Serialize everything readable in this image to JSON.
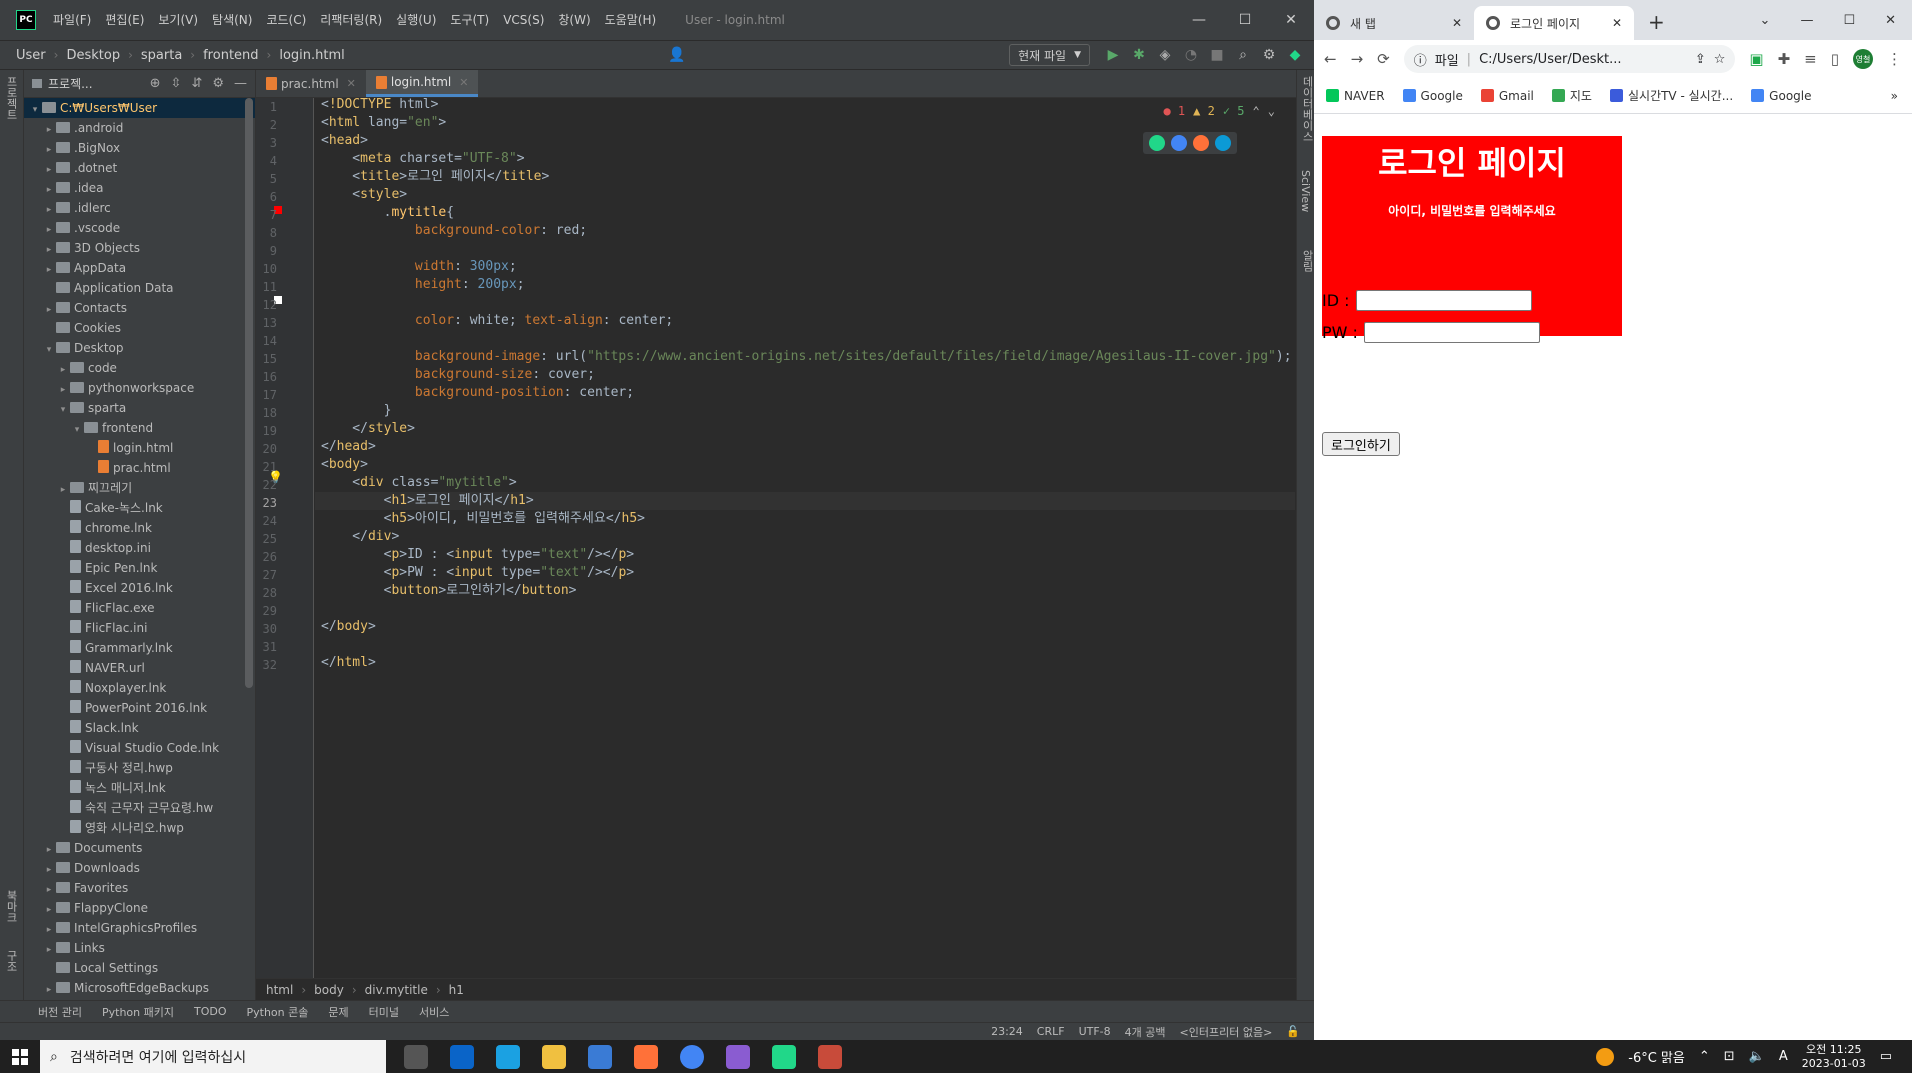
{
  "ide": {
    "logo": "PC",
    "menu": [
      "파일(F)",
      "편집(E)",
      "보기(V)",
      "탐색(N)",
      "코드(C)",
      "리팩터링(R)",
      "실행(U)",
      "도구(T)",
      "VCS(S)",
      "창(W)",
      "도움말(H)"
    ],
    "window_title": "User - login.html",
    "breadcrumbs": [
      "User",
      "Desktop",
      "sparta",
      "frontend",
      "login.html"
    ],
    "run_config": "현재 파일",
    "project_label": "프로젝...",
    "tree": [
      {
        "label": "C:₩Users₩User",
        "depth": 0,
        "type": "folder",
        "arrow": "▾",
        "selected": true
      },
      {
        "label": ".android",
        "depth": 1,
        "type": "folder",
        "arrow": "▸"
      },
      {
        "label": ".BigNox",
        "depth": 1,
        "type": "folder",
        "arrow": "▸"
      },
      {
        "label": ".dotnet",
        "depth": 1,
        "type": "folder",
        "arrow": "▸"
      },
      {
        "label": ".idea",
        "depth": 1,
        "type": "folder",
        "arrow": "▸"
      },
      {
        "label": ".idlerc",
        "depth": 1,
        "type": "folder",
        "arrow": "▸"
      },
      {
        "label": ".vscode",
        "depth": 1,
        "type": "folder",
        "arrow": "▸"
      },
      {
        "label": "3D Objects",
        "depth": 1,
        "type": "folder",
        "arrow": "▸"
      },
      {
        "label": "AppData",
        "depth": 1,
        "type": "folder",
        "arrow": "▸"
      },
      {
        "label": "Application Data",
        "depth": 1,
        "type": "folder",
        "arrow": ""
      },
      {
        "label": "Contacts",
        "depth": 1,
        "type": "folder",
        "arrow": "▸"
      },
      {
        "label": "Cookies",
        "depth": 1,
        "type": "folder",
        "arrow": ""
      },
      {
        "label": "Desktop",
        "depth": 1,
        "type": "folder",
        "arrow": "▾"
      },
      {
        "label": "code",
        "depth": 2,
        "type": "folder",
        "arrow": "▸"
      },
      {
        "label": "pythonworkspace",
        "depth": 2,
        "type": "folder",
        "arrow": "▸"
      },
      {
        "label": "sparta",
        "depth": 2,
        "type": "folder",
        "arrow": "▾"
      },
      {
        "label": "frontend",
        "depth": 3,
        "type": "folder",
        "arrow": "▾"
      },
      {
        "label": "login.html",
        "depth": 4,
        "type": "html",
        "arrow": ""
      },
      {
        "label": "prac.html",
        "depth": 4,
        "type": "html",
        "arrow": ""
      },
      {
        "label": "찌끄레기",
        "depth": 2,
        "type": "folder",
        "arrow": "▸"
      },
      {
        "label": "Cake-녹스.lnk",
        "depth": 2,
        "type": "file",
        "arrow": ""
      },
      {
        "label": "chrome.lnk",
        "depth": 2,
        "type": "file",
        "arrow": ""
      },
      {
        "label": "desktop.ini",
        "depth": 2,
        "type": "file",
        "arrow": ""
      },
      {
        "label": "Epic Pen.lnk",
        "depth": 2,
        "type": "file",
        "arrow": ""
      },
      {
        "label": "Excel 2016.lnk",
        "depth": 2,
        "type": "file",
        "arrow": ""
      },
      {
        "label": "FlicFlac.exe",
        "depth": 2,
        "type": "file",
        "arrow": ""
      },
      {
        "label": "FlicFlac.ini",
        "depth": 2,
        "type": "file",
        "arrow": ""
      },
      {
        "label": "Grammarly.lnk",
        "depth": 2,
        "type": "file",
        "arrow": ""
      },
      {
        "label": "NAVER.url",
        "depth": 2,
        "type": "file",
        "arrow": ""
      },
      {
        "label": "Noxplayer.lnk",
        "depth": 2,
        "type": "file",
        "arrow": ""
      },
      {
        "label": "PowerPoint 2016.lnk",
        "depth": 2,
        "type": "file",
        "arrow": ""
      },
      {
        "label": "Slack.lnk",
        "depth": 2,
        "type": "file",
        "arrow": ""
      },
      {
        "label": "Visual Studio Code.lnk",
        "depth": 2,
        "type": "file",
        "arrow": ""
      },
      {
        "label": "구동사 정리.hwp",
        "depth": 2,
        "type": "file",
        "arrow": ""
      },
      {
        "label": "녹스 매니저.lnk",
        "depth": 2,
        "type": "file",
        "arrow": ""
      },
      {
        "label": "숙직 근무자 근무요령.hw",
        "depth": 2,
        "type": "file",
        "arrow": ""
      },
      {
        "label": "영화 시나리오.hwp",
        "depth": 2,
        "type": "file",
        "arrow": ""
      },
      {
        "label": "Documents",
        "depth": 1,
        "type": "folder",
        "arrow": "▸"
      },
      {
        "label": "Downloads",
        "depth": 1,
        "type": "folder",
        "arrow": "▸"
      },
      {
        "label": "Favorites",
        "depth": 1,
        "type": "folder",
        "arrow": "▸"
      },
      {
        "label": "FlappyClone",
        "depth": 1,
        "type": "folder",
        "arrow": "▸"
      },
      {
        "label": "IntelGraphicsProfiles",
        "depth": 1,
        "type": "folder",
        "arrow": "▸"
      },
      {
        "label": "Links",
        "depth": 1,
        "type": "folder",
        "arrow": "▸"
      },
      {
        "label": "Local Settings",
        "depth": 1,
        "type": "folder",
        "arrow": ""
      },
      {
        "label": "MicrosoftEdgeBackups",
        "depth": 1,
        "type": "folder",
        "arrow": "▸"
      }
    ],
    "editor_tabs": [
      {
        "label": "prac.html",
        "active": false
      },
      {
        "label": "login.html",
        "active": true
      }
    ],
    "inspections": {
      "errors": "1",
      "warnings": "2",
      "ok": "5"
    },
    "code_lines": [
      "<!DOCTYPE html>",
      "<html lang=\"en\">",
      "<head>",
      "    <meta charset=\"UTF-8\">",
      "    <title>로그인 페이지</title>",
      "    <style>",
      "        .mytitle{",
      "            background-color: red;",
      "",
      "            width: 300px;",
      "            height: 200px;",
      "",
      "            color: white; text-align: center;",
      "",
      "            background-image: url(\"https://www.ancient-origins.net/sites/default/files/field/image/Agesilaus-II-cover.jpg\");",
      "            background-size: cover;",
      "            background-position: center;",
      "        }",
      "    </style>",
      "</head>",
      "<body>",
      "    <div class=\"mytitle\">",
      "        <h1>로그인 페이지</h1>",
      "        <h5>아이디, 비밀번호를 입력해주세요</h5>",
      "    </div>",
      "        <p>ID : <input type=\"text\"/></p>",
      "        <p>PW : <input type=\"text\"/></p>",
      "        <button>로그인하기</button>",
      "",
      "</body>",
      "",
      "</html>"
    ],
    "current_line": 23,
    "editor_breadcrumb": [
      "html",
      "body",
      "div.mytitle",
      "h1"
    ],
    "bottom_tools": [
      "버전 관리",
      "Python 패키지",
      "TODO",
      "Python 콘솔",
      "문제",
      "터미널",
      "서비스"
    ],
    "status": [
      "23:24",
      "CRLF",
      "UTF-8",
      "4개 공백",
      "<인터프리터 없음>"
    ],
    "left_vtabs": [
      "프로젝트",
      "북마크",
      "구조"
    ],
    "right_vtabs": [
      "알림",
      "SciView",
      "데이터베이스"
    ]
  },
  "browser": {
    "tabs": [
      {
        "label": "새 탭",
        "active": false
      },
      {
        "label": "로그인 페이지",
        "active": true
      }
    ],
    "address_prefix": "파일",
    "address": "C:/Users/User/Deskt...",
    "profile": "영철",
    "bookmarks": [
      {
        "label": "NAVER",
        "color": "#03c75a"
      },
      {
        "label": "Google",
        "color": "#4285f4"
      },
      {
        "label": "Gmail",
        "color": "#ea4335"
      },
      {
        "label": "지도",
        "color": "#34a853"
      },
      {
        "label": "실시간TV - 실시간...",
        "color": "#3b5bdb"
      },
      {
        "label": "Google",
        "color": "#4285f4"
      }
    ],
    "page": {
      "h1": "로그인 페이지",
      "h5": "아이디, 비밀번호를 입력해주세요",
      "id_label": "ID :",
      "pw_label": "PW :",
      "button": "로그인하기"
    }
  },
  "taskbar": {
    "search_placeholder": "검색하려면 여기에 입력하십시",
    "weather": "-6°C 맑음",
    "ime": "A",
    "time": "오전 11:25",
    "date": "2023-01-03"
  }
}
